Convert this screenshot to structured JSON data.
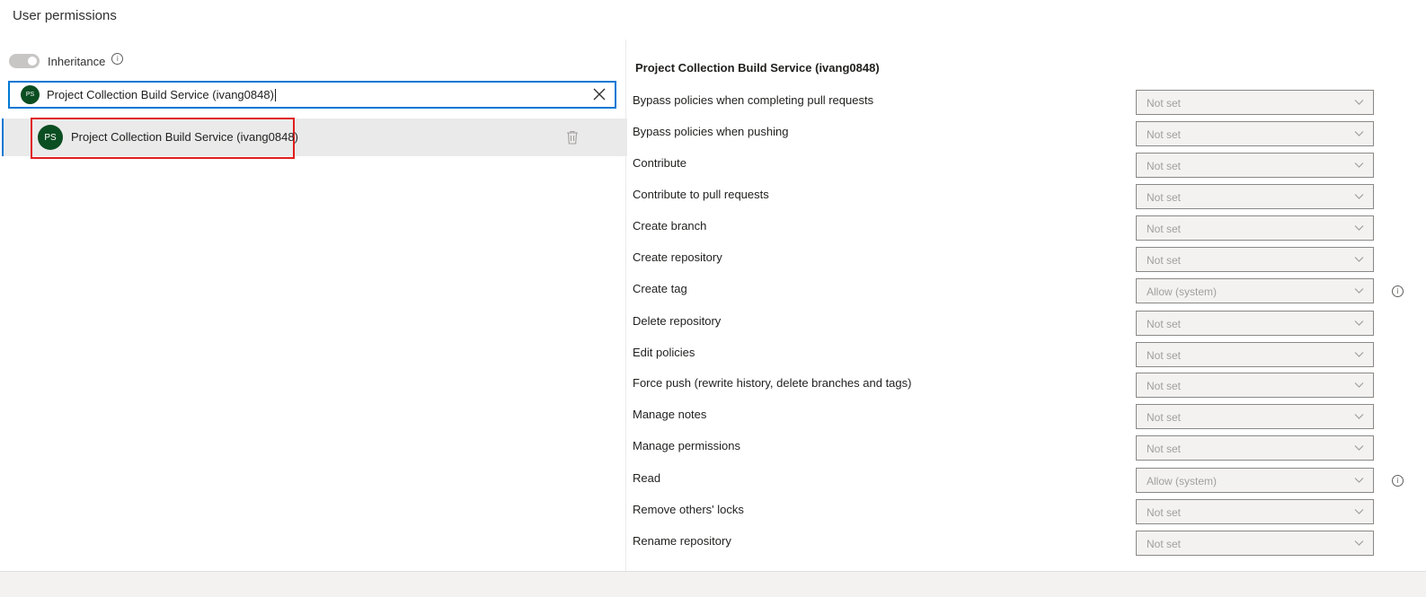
{
  "page": {
    "title": "User permissions"
  },
  "inheritance": {
    "label": "Inheritance",
    "enabled": false
  },
  "search": {
    "avatar_initials": "PS",
    "value": "Project Collection Build Service (ivang0848)"
  },
  "identity_list": [
    {
      "avatar_initials": "PS",
      "name": "Project Collection Build Service (ivang0848)",
      "selected": true
    }
  ],
  "details": {
    "title": "Project Collection Build Service (ivang0848)",
    "permissions": [
      {
        "label": "Bypass policies when completing pull requests",
        "value": "Not set",
        "info": false
      },
      {
        "label": "Bypass policies when pushing",
        "value": "Not set",
        "info": false
      },
      {
        "label": "Contribute",
        "value": "Not set",
        "info": false
      },
      {
        "label": "Contribute to pull requests",
        "value": "Not set",
        "info": false
      },
      {
        "label": "Create branch",
        "value": "Not set",
        "info": false
      },
      {
        "label": "Create repository",
        "value": "Not set",
        "info": false
      },
      {
        "label": "Create tag",
        "value": "Allow (system)",
        "info": true
      },
      {
        "label": "Delete repository",
        "value": "Not set",
        "info": false
      },
      {
        "label": "Edit policies",
        "value": "Not set",
        "info": false
      },
      {
        "label": "Force push (rewrite history, delete branches and tags)",
        "value": "Not set",
        "info": false
      },
      {
        "label": "Manage notes",
        "value": "Not set",
        "info": false
      },
      {
        "label": "Manage permissions",
        "value": "Not set",
        "info": false
      },
      {
        "label": "Read",
        "value": "Allow (system)",
        "info": true
      },
      {
        "label": "Remove others' locks",
        "value": "Not set",
        "info": false
      },
      {
        "label": "Rename repository",
        "value": "Not set",
        "info": false
      }
    ]
  },
  "colors": {
    "accent": "#0078d4",
    "avatar": "#0b4e22",
    "highlight": "#e01e1e"
  }
}
